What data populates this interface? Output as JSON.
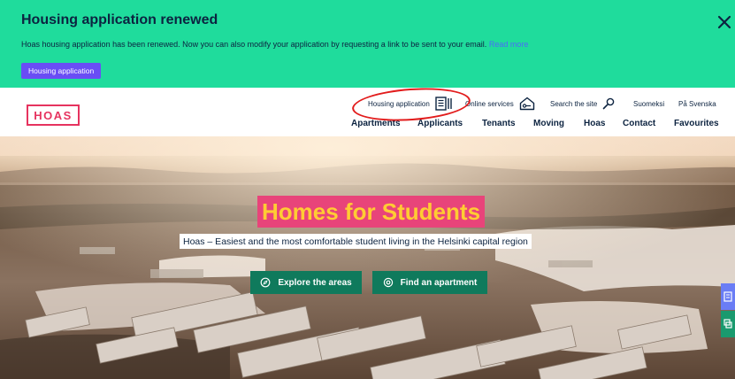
{
  "notice": {
    "title": "Housing application renewed",
    "text": "Hoas housing application has been renewed. Now you can also modify your application by requesting a link to be sent to your email.",
    "link": "Read more",
    "button": "Housing application",
    "close_icon": "close-icon"
  },
  "header": {
    "logo": "HOAS",
    "utility": {
      "housing_application": "Housing application",
      "online_services": "Online services",
      "search": "Search the site",
      "finnish": "Suomeksi",
      "swedish": "På Svenska"
    },
    "nav": [
      "Apartments",
      "Applicants",
      "Tenants",
      "Moving",
      "Hoas",
      "Contact",
      "Favourites"
    ]
  },
  "hero": {
    "title": "Homes for Students",
    "subtitle": "Hoas – Easiest and the most comfortable student living in the Helsinki capital region",
    "cta_explore": "Explore the areas",
    "cta_find": "Find an apartment"
  },
  "colors": {
    "banner": "#1fdc9c",
    "brand": "#e6335f",
    "title_bg": "#e8447a",
    "title_text": "#ffcc33",
    "cta": "#0f7a5c",
    "side_blue": "#6a7df5",
    "side_green": "#1a9a6e"
  }
}
